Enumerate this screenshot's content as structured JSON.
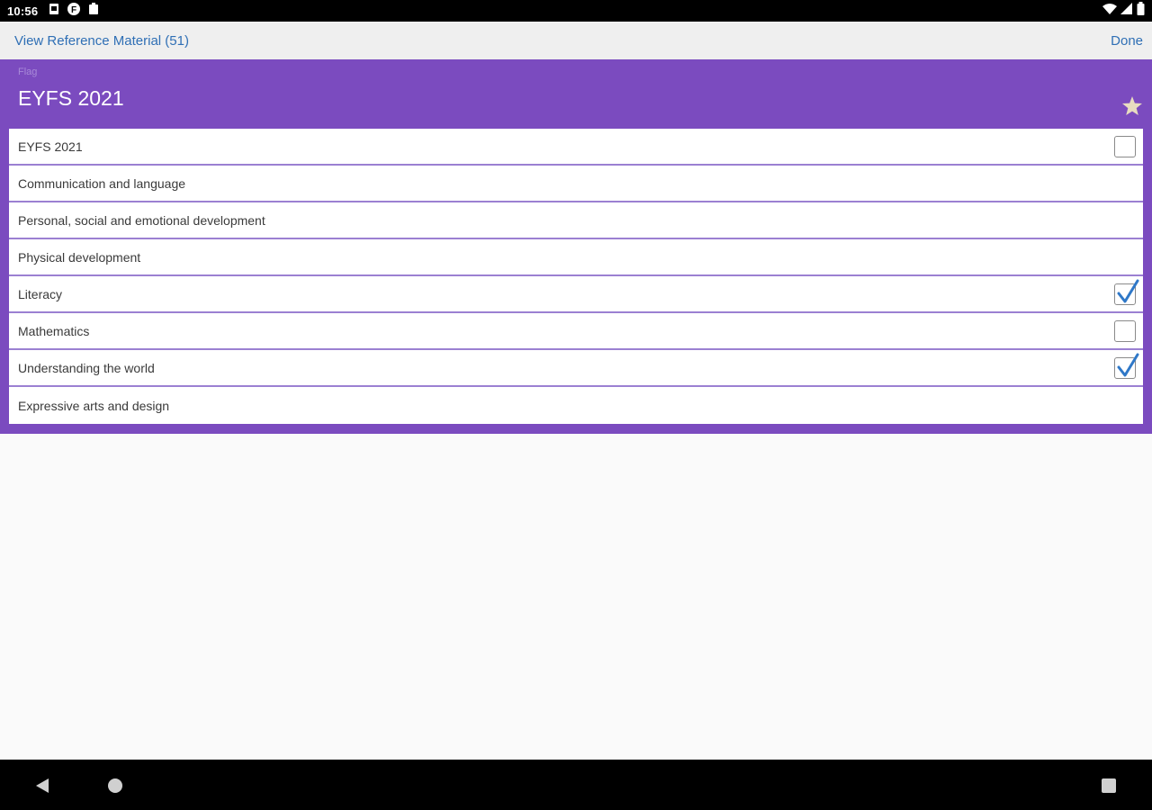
{
  "status_bar": {
    "time": "10:56",
    "icons_left": [
      "sd-card-icon",
      "app-icon",
      "clipboard-icon"
    ],
    "icons_right": [
      "wifi-icon",
      "signal-icon",
      "battery-icon"
    ]
  },
  "action_bar": {
    "left_link": "View Reference Material (51)",
    "right_link": "Done"
  },
  "panel": {
    "small_label": "Flag",
    "title": "EYFS 2021",
    "accent_color": "#7b4bbf",
    "star_color": "#e8dcc0"
  },
  "list": {
    "items": [
      {
        "label": "EYFS 2021",
        "checkbox": "unchecked"
      },
      {
        "label": "Communication and language",
        "checkbox": "none"
      },
      {
        "label": "Personal, social and emotional development",
        "checkbox": "none"
      },
      {
        "label": "Physical development",
        "checkbox": "none"
      },
      {
        "label": "Literacy",
        "checkbox": "checked"
      },
      {
        "label": "Mathematics",
        "checkbox": "unchecked"
      },
      {
        "label": "Understanding the world",
        "checkbox": "checked"
      },
      {
        "label": "Expressive arts and design",
        "checkbox": "none"
      }
    ],
    "check_color": "#2f78c8"
  },
  "nav_bar": {
    "icons": [
      "back-icon",
      "home-icon",
      "recents-icon"
    ]
  }
}
